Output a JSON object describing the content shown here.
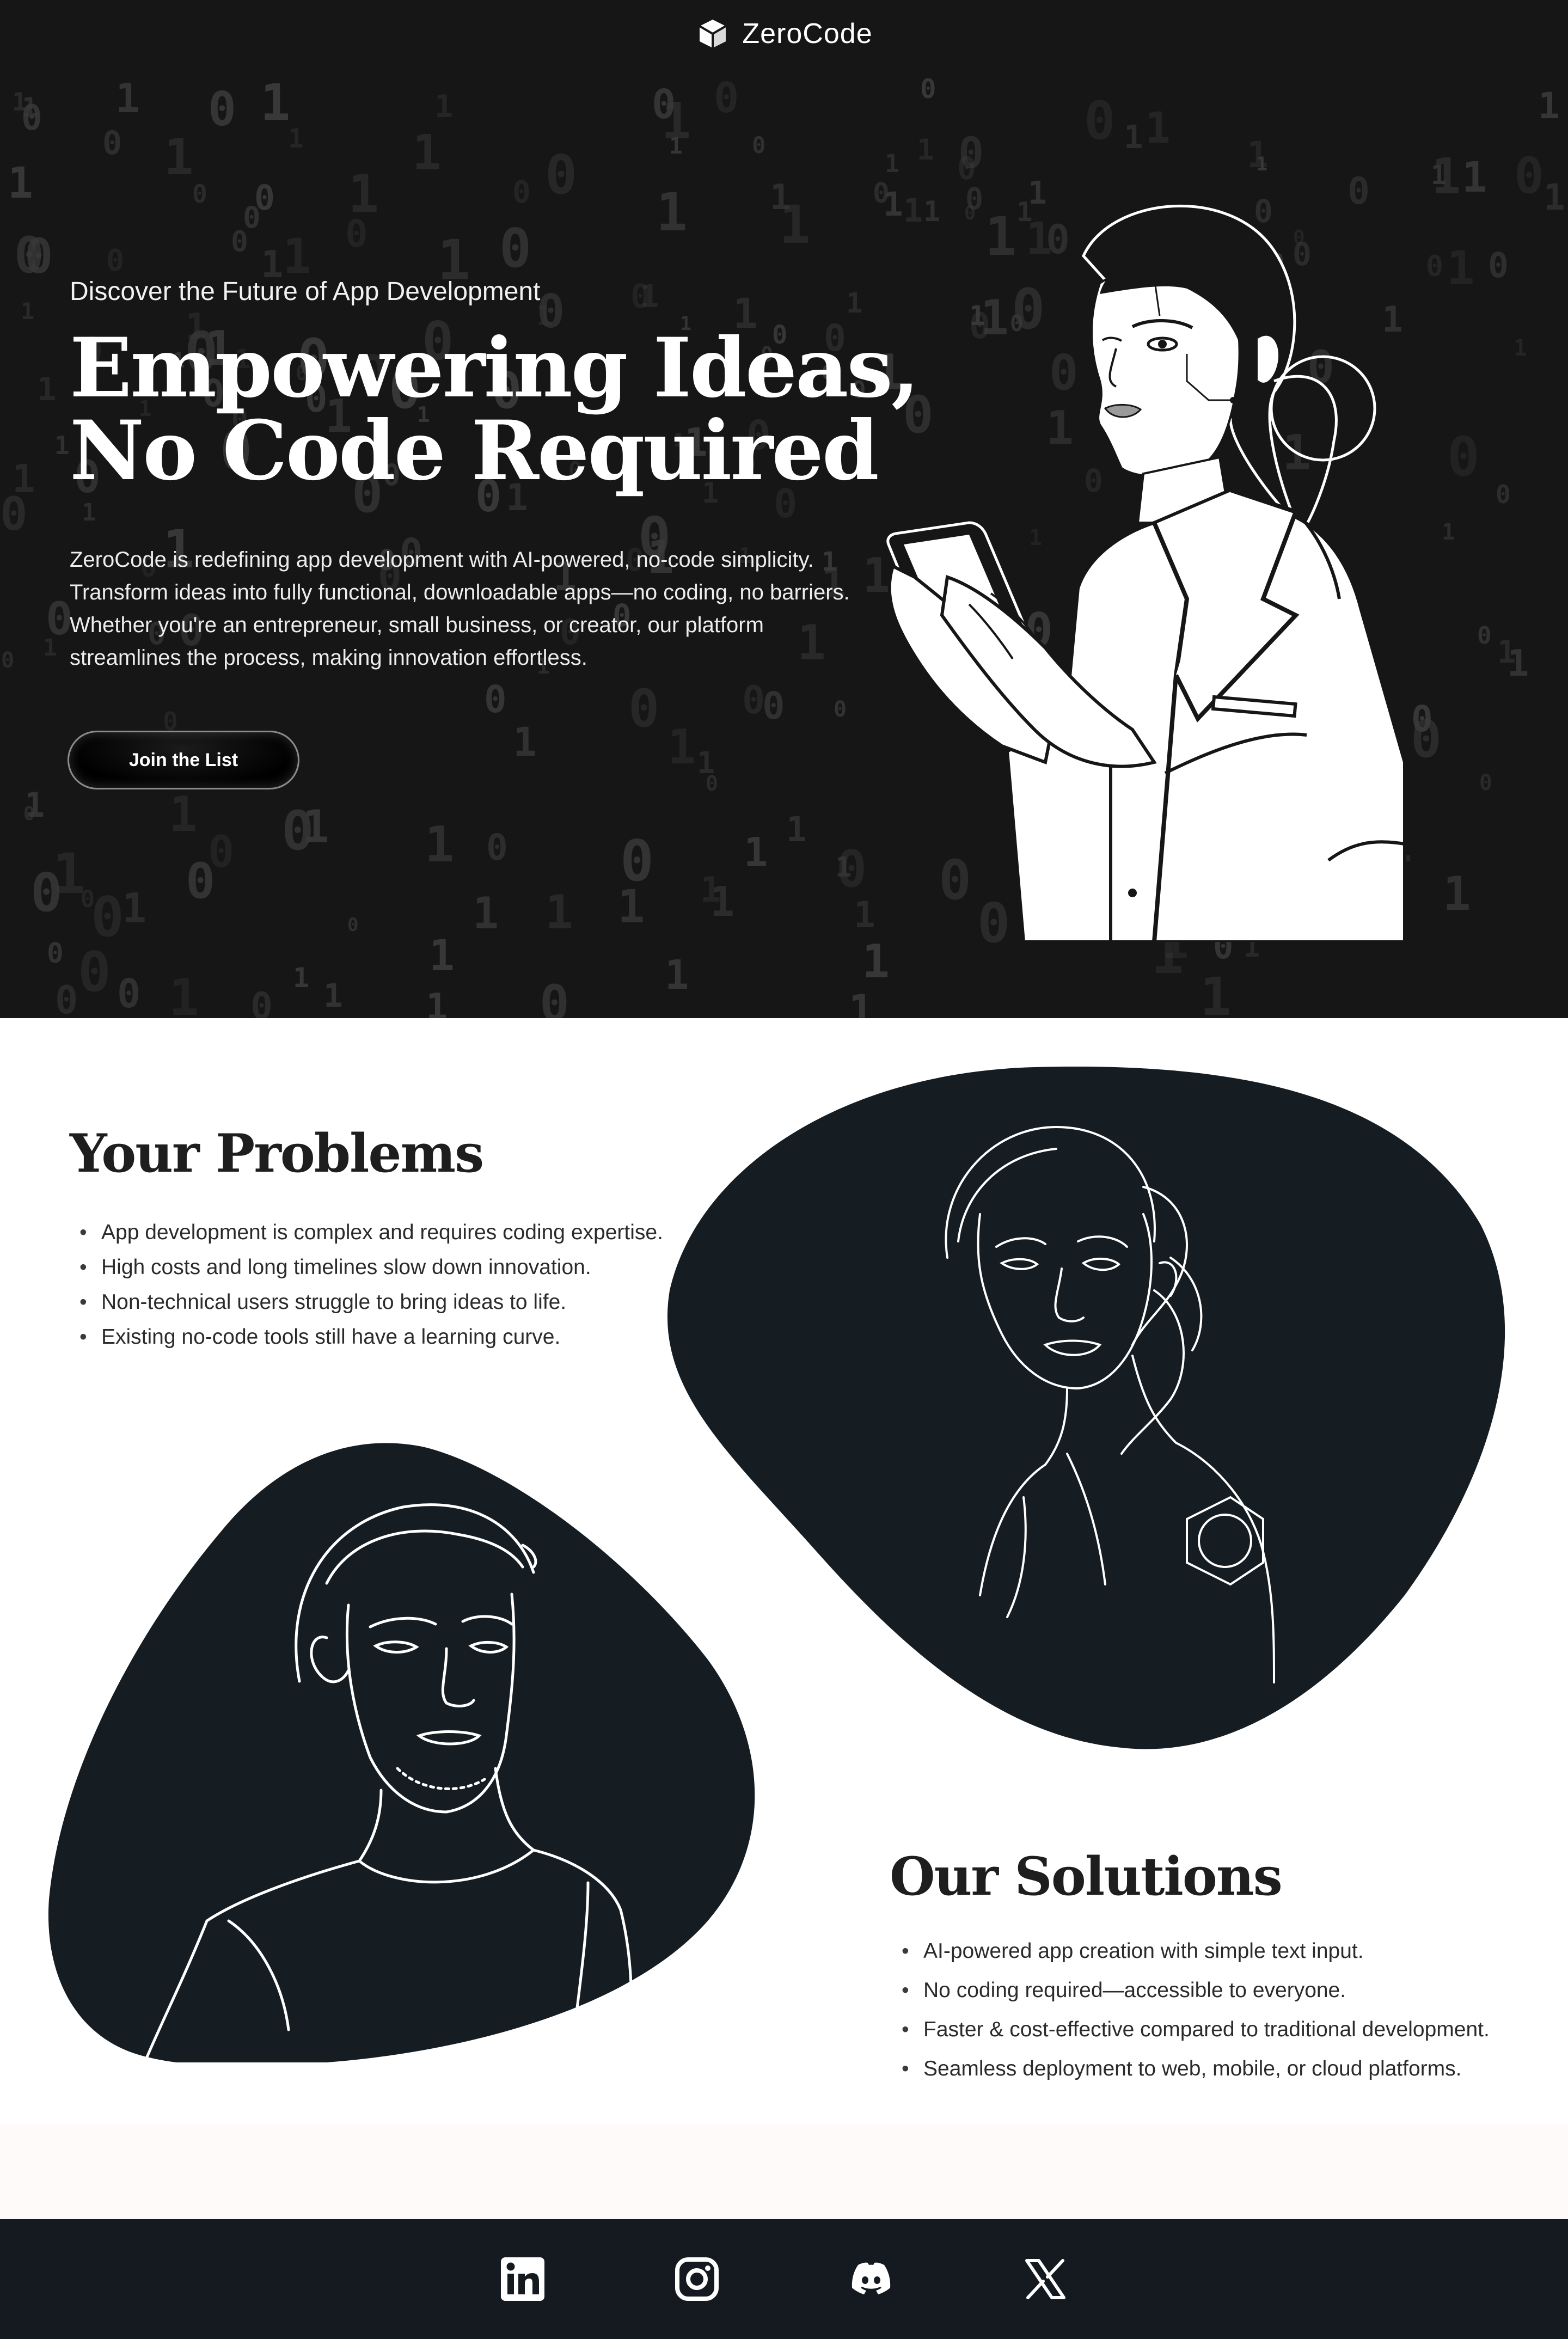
{
  "header": {
    "brand_name": "ZeroCode",
    "brand_icon": "cube-icon"
  },
  "hero": {
    "eyebrow": "Discover the Future of App Development",
    "title_line1": "Empowering Ideas,",
    "title_line2": "No Code Required",
    "description": "ZeroCode is redefining app development with AI-powered, no-code simplicity. Transform ideas into fully functional, downloadable apps—no coding, no barriers. Whether you're an entrepreneur, small business, or creator, our platform streamlines the process, making innovation effortless.",
    "cta_label": "Join the List"
  },
  "problems": {
    "title": "Your Problems",
    "items": [
      "App development is complex and requires coding expertise.",
      "High costs and long timelines slow down innovation.",
      "Non-technical users struggle to bring ideas to life.",
      "Existing no-code tools still have a learning curve."
    ]
  },
  "solutions": {
    "title": "Our Solutions",
    "items": [
      "AI-powered app creation with simple text input.",
      "No coding required—accessible to everyone.",
      "Faster & cost-effective compared to traditional development.",
      "Seamless deployment to web, mobile, or cloud platforms."
    ]
  },
  "footer": {
    "social": [
      {
        "icon": "linkedin-icon"
      },
      {
        "icon": "instagram-icon"
      },
      {
        "icon": "discord-icon"
      },
      {
        "icon": "x-icon"
      }
    ]
  },
  "colors": {
    "hero_bg": "#161616",
    "blob_fill": "#161d22",
    "footer_bg": "#141a1f",
    "text_dark": "#1e1e1e"
  }
}
